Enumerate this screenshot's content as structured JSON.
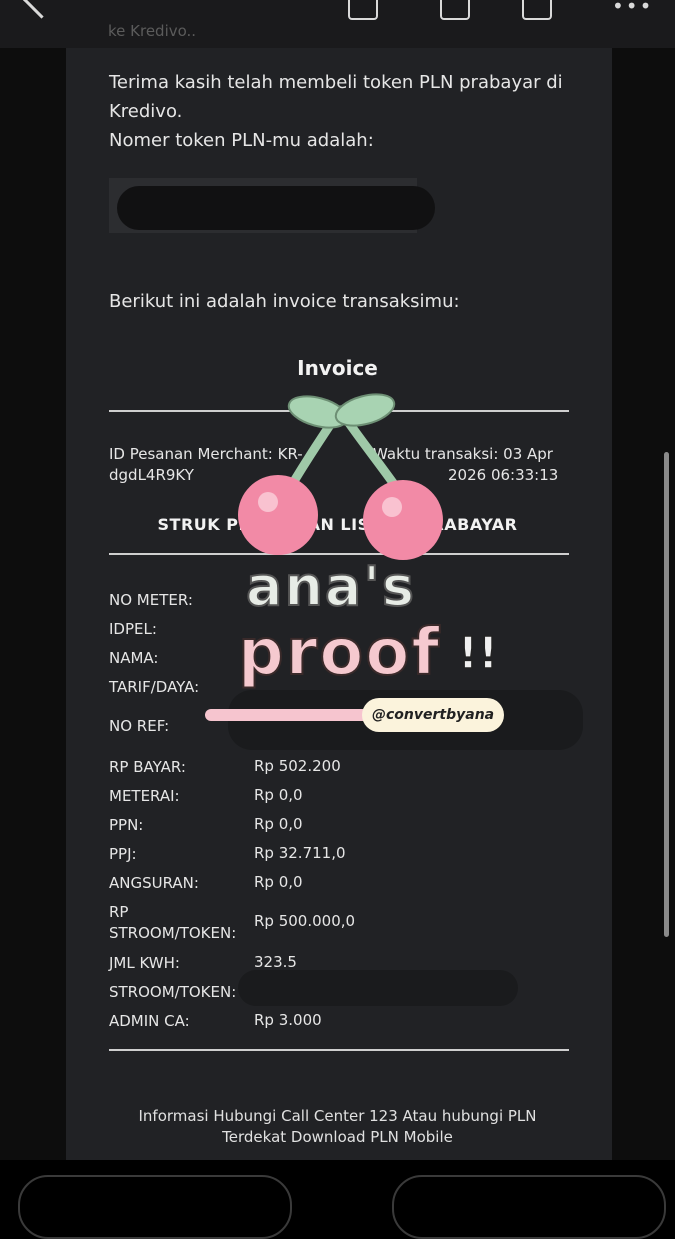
{
  "header": {
    "sender_partial": "ke Kredivo..",
    "icons": [
      "back-arrow-icon",
      "download-icon",
      "delete-icon",
      "more-icon"
    ]
  },
  "email": {
    "thanks_line1": "Terima kasih telah membeli token PLN prabayar di",
    "thanks_line2": "Kredivo.",
    "token_label": "Nomer token PLN-mu adalah:",
    "invoice_intro": "Berikut ini adalah invoice transaksimu:",
    "invoice_title": "Invoice",
    "merchant_id_label": "ID Pesanan Merchant: KR-",
    "merchant_id_value": "dgdL4R9KY",
    "transaction_time_label": "Waktu transaksi: 03 Apr",
    "transaction_time_value": "2026 06:33:13",
    "struk_title": "STRUK PEMBELIAN LISTRIK PRABAYAR",
    "details": [
      {
        "label": "NO METER:",
        "value": ""
      },
      {
        "label": "IDPEL:",
        "value": ""
      },
      {
        "label": "NAMA:",
        "value": ""
      },
      {
        "label": "TARIF/DAYA:",
        "value": ""
      },
      {
        "label": "NO REF:",
        "value": ""
      },
      {
        "label": "RP BAYAR:",
        "value": "Rp 502.200"
      },
      {
        "label": "METERAI:",
        "value": "Rp 0,0"
      },
      {
        "label": "PPN:",
        "value": "Rp 0,0"
      },
      {
        "label": "PPJ:",
        "value": "Rp 32.711,0"
      },
      {
        "label": "ANGSURAN:",
        "value": "Rp 0,0"
      },
      {
        "label": "RP STROOM/TOKEN:",
        "label_line1": "RP",
        "label_line2": "STROOM/TOKEN:",
        "value": "Rp 500.000,0"
      },
      {
        "label": "JML KWH:",
        "value": "323.5"
      },
      {
        "label": "STROOM/TOKEN:",
        "value": ""
      },
      {
        "label": "ADMIN CA:",
        "value": "Rp 3.000"
      }
    ],
    "footer_line1": "Informasi Hubungi Call Center 123 Atau hubungi PLN",
    "footer_line2": "Terdekat Download PLN Mobile"
  },
  "sticker": {
    "line1": "ana's",
    "line2": "proof",
    "bang": "!!",
    "handle": "@convertbyana"
  },
  "colors": {
    "background": "#000000",
    "card": "#212225",
    "text": "#e6e6e6",
    "sticker_pink": "#f5c9cf",
    "sticker_green": "#9fc9a8"
  }
}
